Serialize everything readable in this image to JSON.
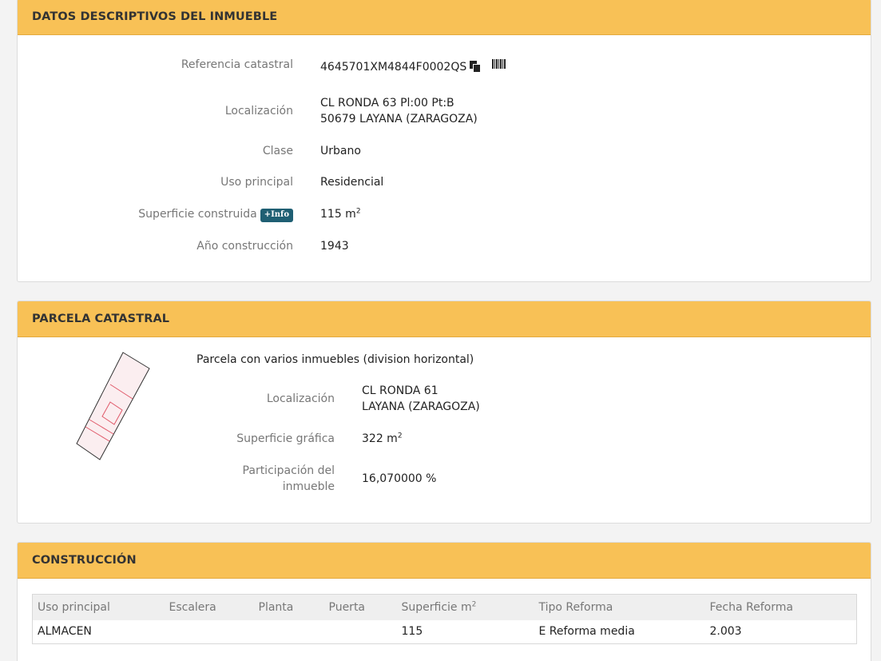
{
  "datos": {
    "title": "DATOS DESCRIPTIVOS DEL INMUEBLE",
    "referencia_label": "Referencia catastral",
    "referencia_value": "4645701XM4844F0002QS",
    "localizacion_label": "Localización",
    "localizacion_line1": "CL RONDA 63 Pl:00 Pt:B",
    "localizacion_line2": "50679 LAYANA (ZARAGOZA)",
    "clase_label": "Clase",
    "clase_value": "Urbano",
    "uso_label": "Uso principal",
    "uso_value": "Residencial",
    "superficie_label": "Superficie construida",
    "info_badge": "+Info",
    "superficie_value": "115 m",
    "superficie_unit_sup": "2",
    "anio_label": "Año construcción",
    "anio_value": "1943"
  },
  "parcela": {
    "title": "PARCELA CATASTRAL",
    "description": "Parcela con varios inmuebles (division horizontal)",
    "localizacion_label": "Localización",
    "localizacion_line1": "CL RONDA 61",
    "localizacion_line2": "LAYANA (ZARAGOZA)",
    "superficie_label": "Superficie gráfica",
    "superficie_value": "322 m",
    "superficie_unit_sup": "2",
    "participacion_label_1": "Participación del",
    "participacion_label_2": "inmueble",
    "participacion_value": "16,070000 %"
  },
  "construccion": {
    "title": "CONSTRUCCIÓN",
    "columns": [
      "Uso principal",
      "Escalera",
      "Planta",
      "Puerta",
      "Superficie m",
      "Tipo Reforma",
      "Fecha Reforma"
    ],
    "superficie_col_sup": "2",
    "rows": [
      [
        "ALMACEN",
        "",
        "",
        "",
        "115",
        "E Reforma media",
        "2.003"
      ]
    ]
  },
  "colors": {
    "header_bg": "#f8c156",
    "badge_bg": "#1f5f73",
    "parcel_outline": "#333333",
    "parcel_unit": "#e05a6a"
  },
  "icons": [
    "copy-icon",
    "barcode-icon",
    "parcel-map-icon"
  ]
}
